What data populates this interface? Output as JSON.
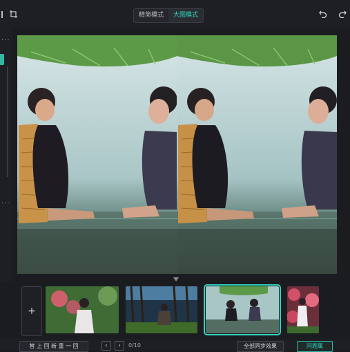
{
  "mode_tabs": {
    "fine": "精简模式",
    "large": "大图模式"
  },
  "thumb_add": "+",
  "bottom": {
    "left_button": "替 上 回 新 重 一 回",
    "page_label": "0/10",
    "sync_button": "全部同步效果",
    "confirm_button": "问题属"
  },
  "icons": {
    "menu": "hamburger-icon",
    "crop": "crop-icon",
    "undo": "undo-icon",
    "redo": "redo-icon"
  },
  "colors": {
    "accent": "#2fd3be",
    "panel": "#1b1c20"
  }
}
